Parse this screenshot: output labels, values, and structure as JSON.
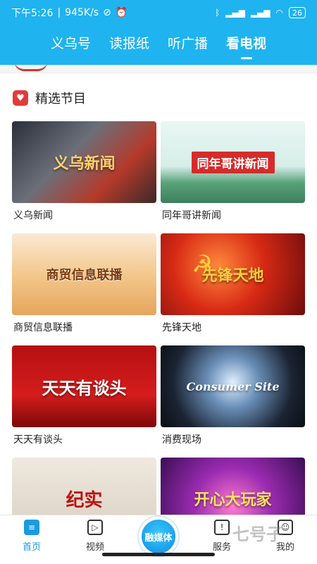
{
  "status_bar": {
    "time": "下午5:26",
    "speed": "945K/s",
    "battery": "26"
  },
  "top_tabs": [
    {
      "label": "义乌号"
    },
    {
      "label": "读报纸"
    },
    {
      "label": "听广播"
    },
    {
      "label": "看电视",
      "active": true
    }
  ],
  "section": {
    "title": "精选节目"
  },
  "programs": [
    {
      "name": "义乌新闻",
      "thumb_text": "义乌新闻"
    },
    {
      "name": "同年哥讲新闻",
      "thumb_text": "同年哥讲新闻"
    },
    {
      "name": "商贸信息联播",
      "thumb_text": "商贸信息联播"
    },
    {
      "name": "先锋天地",
      "thumb_text": "先锋天地"
    },
    {
      "name": "天天有谈头",
      "thumb_text": "天天有谈头"
    },
    {
      "name": "消费现场",
      "thumb_text": "Consumer Site"
    },
    {
      "name": "",
      "thumb_text": "纪实"
    },
    {
      "name": "",
      "thumb_text": "开心大玩家"
    }
  ],
  "bottom_nav": {
    "home": "首页",
    "video": "视频",
    "center": "融媒体",
    "service": "服务",
    "mine": "我的"
  },
  "watermark": "七号子",
  "colors": {
    "brand_blue": "#1fb3f0",
    "nav_active": "#1a9be0",
    "section_icon_red": "#e23b3b"
  }
}
